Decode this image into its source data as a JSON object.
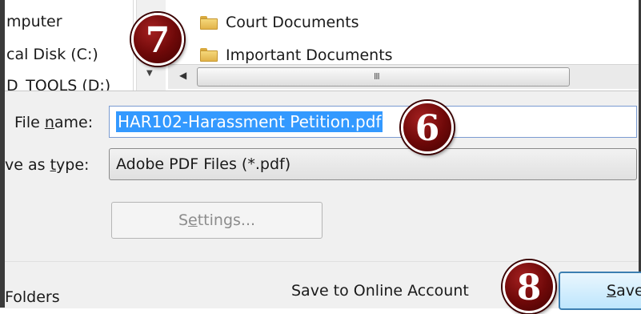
{
  "tree": {
    "items": [
      "mputer",
      "cal Disk (C:)",
      "D_TOOLS (D:)"
    ]
  },
  "file_list": {
    "items": [
      "Court Documents",
      "Important Documents"
    ]
  },
  "scrollbar": {
    "grip": "III"
  },
  "form": {
    "file_name_label_pre": "File ",
    "file_name_label_accel": "n",
    "file_name_label_post": "ame:",
    "file_name_value": "HAR102-Harassment Petition.pdf",
    "save_type_label_pre": "ve as ",
    "save_type_label_accel": "t",
    "save_type_label_post": "ype:",
    "save_type_value": "Adobe PDF Files (*.pdf)",
    "settings_pre": "S",
    "settings_accel": "e",
    "settings_post": "ttings..."
  },
  "footer": {
    "folders_label": "Folders",
    "online_label": "Save to Online Account",
    "save_accel": "S",
    "save_post": "ave"
  },
  "callouts": {
    "file_list": "7",
    "file_name": "6",
    "save": "8"
  },
  "colors": {
    "selection": "#3399ff",
    "callout": "#6d0808",
    "folder": "#e2b34a"
  }
}
